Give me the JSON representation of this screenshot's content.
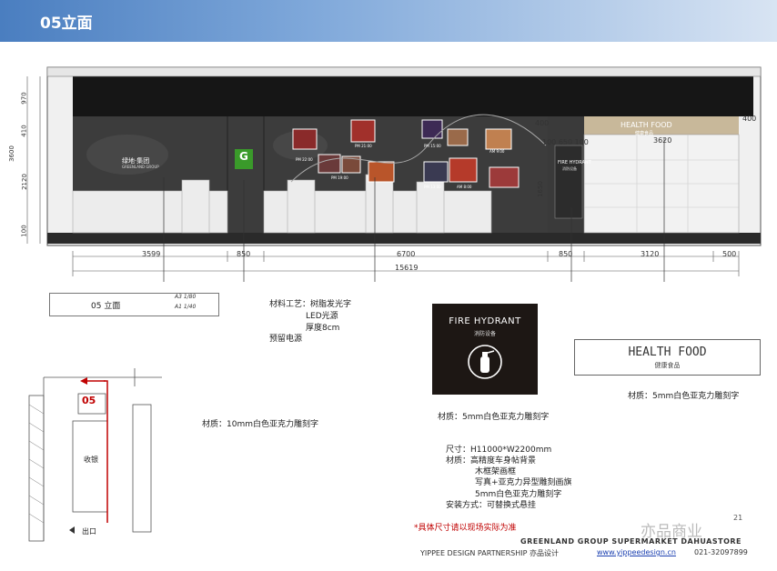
{
  "header": {
    "title": "05立面"
  },
  "vertical_dims": {
    "d970": "970",
    "d410": "410",
    "d2120": "2120",
    "d100": "100",
    "total": "3600"
  },
  "right_dims": {
    "d400a": "400",
    "d400b": "400",
    "d3620": "3620",
    "d1650": "1650",
    "d100_650_100": "100 650 100"
  },
  "horizontal_dims": {
    "d3599": "3599",
    "d850a": "850",
    "d6700": "6700",
    "d850b": "850",
    "d3120": "3120",
    "d500": "500",
    "total": "15619"
  },
  "elevation": {
    "brand_name": "绿地·集团",
    "brand_sub": "GREENLAND GROUP",
    "g_logo": "G",
    "health_food_band": "HEALTH FOOD",
    "health_food_band_sub": "健康食品",
    "fire_small": "FIRE HYDRANT",
    "fire_small_sub": "消防设备",
    "pm_labels": [
      "PM 22:00",
      "PM 21:00",
      "PM 15:00",
      "AM 9:00",
      "PM 19:00",
      "PM 13:00",
      "AM 8:00"
    ]
  },
  "title_block": {
    "label": "05 立面",
    "scale_a3": "A3  1/80",
    "scale_a1": "A1  1/40"
  },
  "notes": {
    "material_process_1": "材料工艺：树脂发光字",
    "material_process_2": "LED光源",
    "material_process_3": "厚度8cm",
    "material_process_4": "预留电源",
    "material_left": "材质：10mm白色亚克力雕刻字",
    "material_fire": "材质：5mm白色亚克力雕刻字",
    "material_health": "材质：5mm白色亚克力雕刻字",
    "spec_1": "尺寸：H11000*W2200mm",
    "spec_2": "材质：高精度车身帖背景",
    "spec_3": "木框架画框",
    "spec_4": "写真+亚克力异型雕刻画旗",
    "spec_5": "5mm白色亚克力雕刻字",
    "spec_6": "安装方式：可替换式悬挂",
    "red_note": "*具体尺寸请以现场实际为准"
  },
  "fire_sign": {
    "title": "FIRE HYDRANT",
    "sub": "消防设备"
  },
  "health_sign": {
    "title": "HEALTH FOOD",
    "sub": "健康食品"
  },
  "plan": {
    "label_05": "05",
    "cashier": "收银",
    "exit": "出口"
  },
  "footer": {
    "page": "21",
    "line1": "GREENLAND GROUP SUPERMARKET DAHUASTORE",
    "line2_prefix": "YIPPEE DESIGN PARTNERSHIP 亦品设计",
    "url": "www.yippeedesign.cn",
    "phone": "021-32097899",
    "watermark": "亦品商业"
  },
  "colors": {
    "header_start": "#4a7ec0",
    "wall_dark": "#3a3a3a",
    "ceiling": "#161616",
    "accent_red": "#c00000",
    "sign_gold": "#c8b89a"
  }
}
